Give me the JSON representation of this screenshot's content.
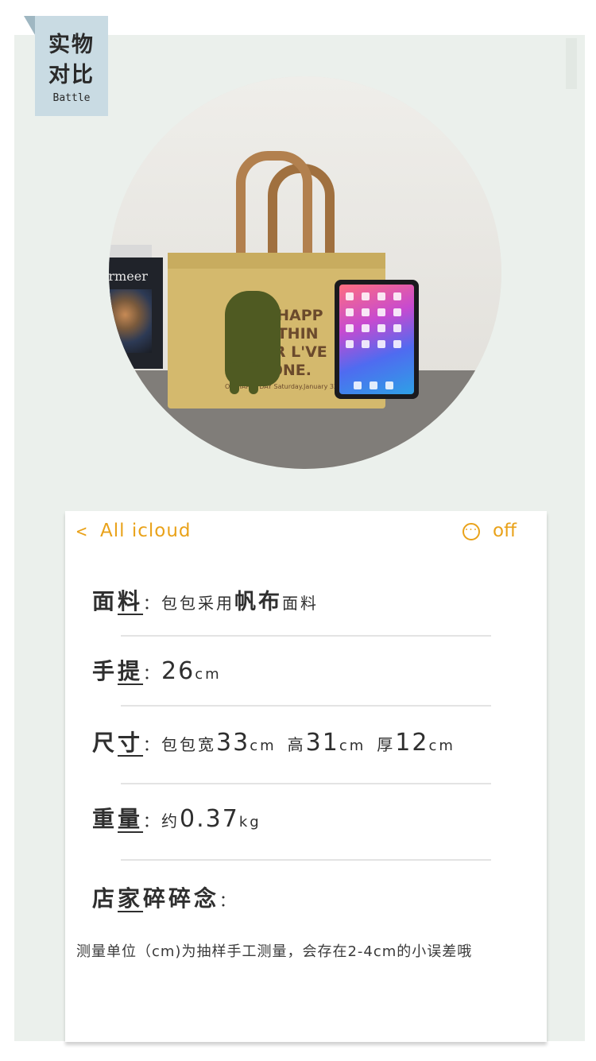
{
  "badge": {
    "line1": "实物",
    "line2": "对比",
    "en": "Battle"
  },
  "photo": {
    "bag_text": "ON HAPP\nST THIN\nVEER L'VE\nDONE.",
    "bag_small_text": "ON HAPPY DAY Saturday.January 33",
    "book_title": "ermeer"
  },
  "card": {
    "header": {
      "back_label": "All icloud",
      "more_label": "off"
    },
    "fabric": {
      "label_a": "面",
      "label_b": "料",
      "value_pre": "包包采用",
      "value_emph": "帆布",
      "value_post": "面料"
    },
    "handle": {
      "label_a": "手",
      "label_b": "提",
      "value": "26",
      "unit": "cm"
    },
    "size": {
      "label_a": "尺",
      "label_b": "寸",
      "width_label": "包包宽",
      "width": "33",
      "height_label": "高",
      "height": "31",
      "depth_label": "厚",
      "depth": "12",
      "unit": "cm"
    },
    "weight": {
      "label_a": "重",
      "label_b": "量",
      "prefix": "约",
      "value": "0.37",
      "unit": "kg"
    },
    "notes": {
      "label_a": "店",
      "label_b": "家",
      "label_c": "碎碎念"
    },
    "note_text": "测量单位（cm)为抽样手工测量，会存在2-4cm的小误差哦"
  },
  "colors": {
    "accent": "#e9a21a",
    "panel_bg": "#ebf0ec",
    "badge_bg": "#c9dbe3"
  }
}
